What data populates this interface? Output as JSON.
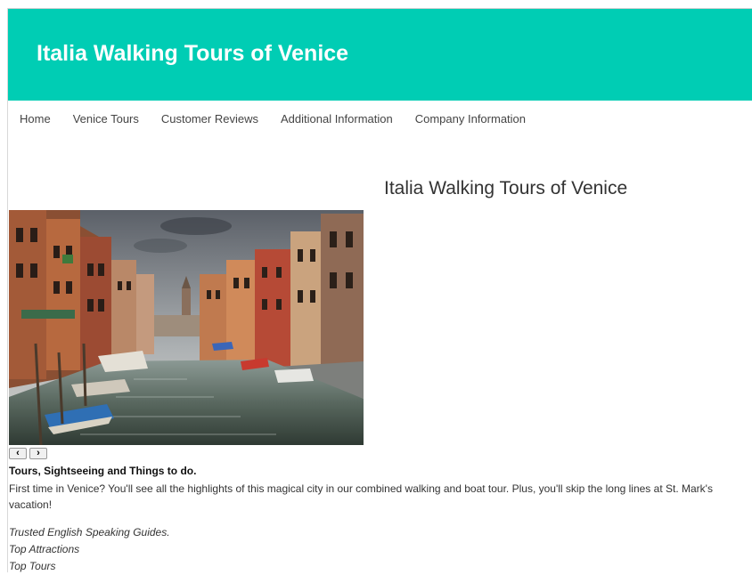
{
  "header": {
    "title": "Italia Walking Tours of Venice"
  },
  "nav": {
    "items": [
      {
        "label": "Home"
      },
      {
        "label": "Venice Tours"
      },
      {
        "label": "Customer Reviews"
      },
      {
        "label": "Additional Information"
      },
      {
        "label": "Company Information"
      }
    ]
  },
  "main": {
    "heading": "Italia Walking Tours of Venice",
    "slider": {
      "prev_icon": "‹",
      "next_icon": "›"
    },
    "section_title": "Tours, Sightseeing and Things to do.",
    "intro_line1": "First time in Venice? You'll see all the highlights of this magical city in our combined walking and boat tour. Plus, you'll skip the long lines at St. Mark's",
    "intro_line2": "vacation!",
    "features": [
      "Trusted English Speaking Guides.",
      "Top Attractions",
      "Top Tours"
    ]
  },
  "colors": {
    "header_bg": "#00cdb4",
    "header_text": "#ffffff"
  }
}
